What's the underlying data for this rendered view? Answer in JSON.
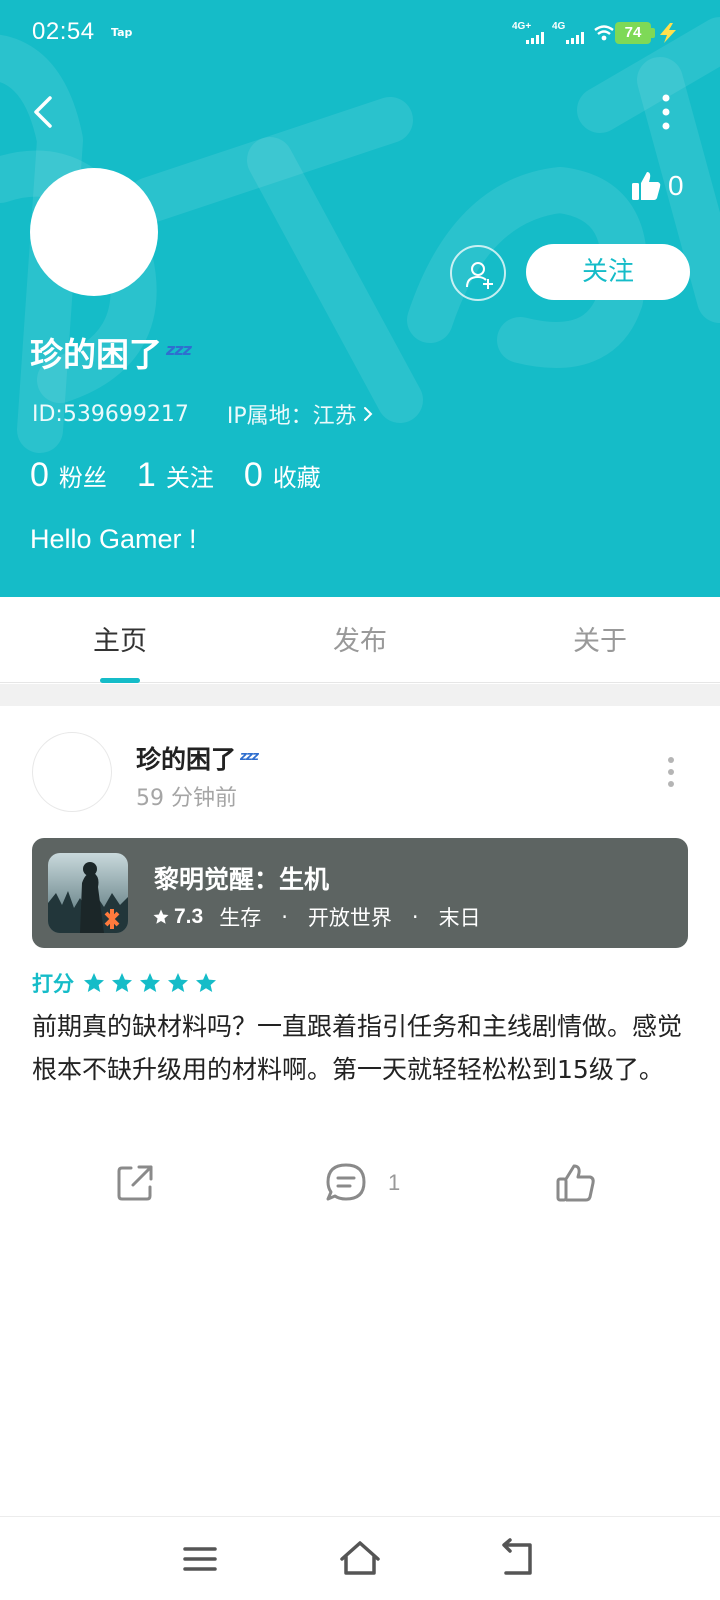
{
  "status_bar": {
    "time": "02:54",
    "carrier_tag": "Tap",
    "signal1_label": "4G+",
    "signal2_label": "4G",
    "battery": "74"
  },
  "profile": {
    "likes_count": "0",
    "follow_label": "关注",
    "nickname": "珍的困了",
    "zzz": "zzz",
    "id_text": "ID:539699217",
    "ip_text": "IP属地：江苏",
    "stats": [
      {
        "num": "0",
        "label": "粉丝"
      },
      {
        "num": "1",
        "label": "关注"
      },
      {
        "num": "0",
        "label": "收藏"
      }
    ],
    "bio": "Hello Gamer !"
  },
  "tabs": [
    {
      "label": "主页",
      "active": true
    },
    {
      "label": "发布",
      "active": false
    },
    {
      "label": "关于",
      "active": false
    }
  ],
  "post": {
    "author": "珍的困了",
    "time": "59 分钟前",
    "game": {
      "title": "黎明觉醒：生机",
      "rating": "7.3",
      "tags": [
        "生存",
        "开放世界",
        "末日"
      ]
    },
    "score_label": "打分",
    "stars": 5,
    "review": "前期真的缺材料吗？一直跟着指引任务和主线剧情做。感觉根本不缺升级用的材料啊。第一天就轻轻松松到15级了。",
    "comment_count": "1"
  },
  "colors": {
    "brand": "#15bcc8",
    "card_bg": "#5d6462",
    "zzz": "#2f6fcf"
  },
  "icons": [
    "back-icon",
    "more-vertical-icon",
    "thumb-up-icon",
    "add-user-icon",
    "chevron-right-icon",
    "star-icon",
    "share-icon",
    "comment-icon",
    "menu-icon",
    "home-icon",
    "return-icon"
  ]
}
